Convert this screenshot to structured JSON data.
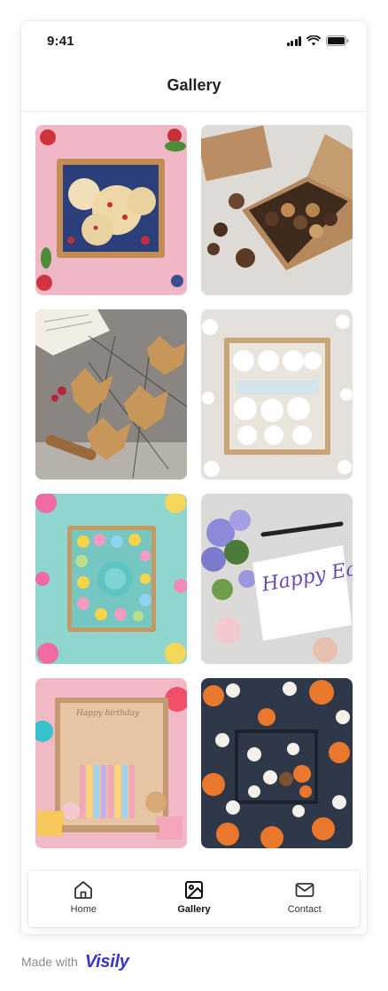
{
  "status_bar": {
    "time": "9:41"
  },
  "header": {
    "title": "Gallery"
  },
  "gallery": {
    "items": [
      {
        "name": "berry-cookies-box"
      },
      {
        "name": "chocolate-cookies-box"
      },
      {
        "name": "maple-leaf-cookies"
      },
      {
        "name": "snowflake-cookies-box"
      },
      {
        "name": "flower-cookies-box"
      },
      {
        "name": "happy-easter-card",
        "card_text": "Happy Easter!"
      },
      {
        "name": "birthday-cake-box",
        "card_text": "Happy birthday"
      },
      {
        "name": "halloween-cookies"
      }
    ]
  },
  "tabbar": {
    "items": [
      {
        "label": "Home",
        "icon": "home-icon",
        "active": false
      },
      {
        "label": "Gallery",
        "icon": "image-icon",
        "active": true
      },
      {
        "label": "Contact",
        "icon": "mail-icon",
        "active": false
      }
    ]
  },
  "footer": {
    "made_with": "Made with",
    "brand": "Visily"
  },
  "colors": {
    "brand": "#3b36c9",
    "text": "#1a1a1a",
    "divider": "#ececec"
  }
}
